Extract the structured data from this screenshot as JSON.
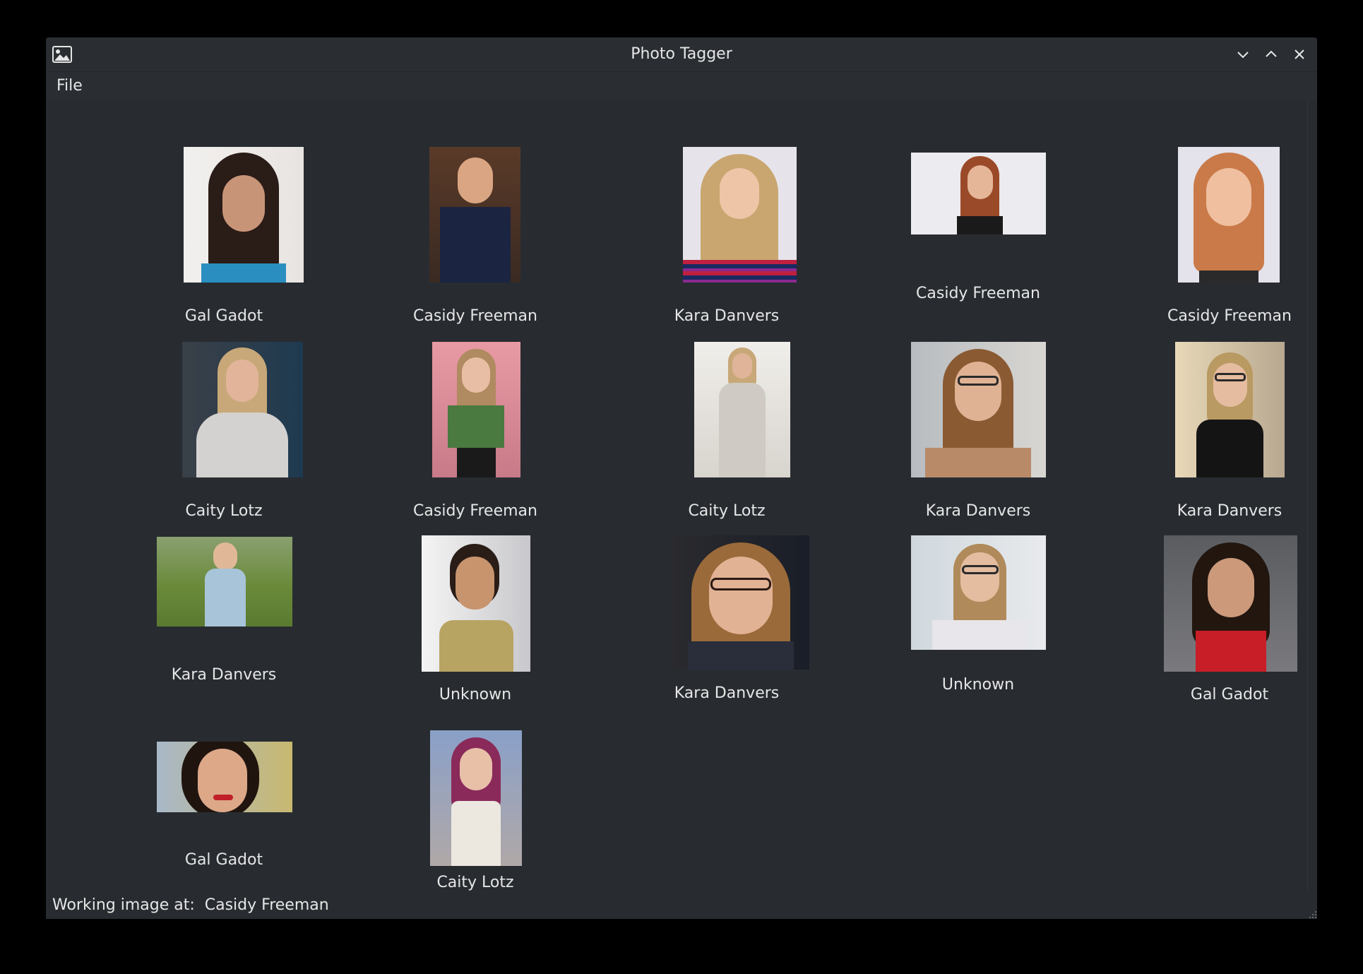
{
  "window": {
    "title": "Photo Tagger",
    "icon": "image-icon",
    "controls": [
      "minimize-icon",
      "maximize-icon",
      "close-icon"
    ]
  },
  "menu": {
    "items": [
      {
        "label": "File"
      }
    ]
  },
  "grid": {
    "items": [
      {
        "label": "Gal Gadot"
      },
      {
        "label": "Casidy Freeman"
      },
      {
        "label": "Kara Danvers"
      },
      {
        "label": "Casidy Freeman"
      },
      {
        "label": "Casidy Freeman"
      },
      {
        "label": "Caity Lotz"
      },
      {
        "label": "Casidy Freeman"
      },
      {
        "label": "Caity Lotz"
      },
      {
        "label": "Kara Danvers"
      },
      {
        "label": "Kara Danvers"
      },
      {
        "label": "Kara Danvers"
      },
      {
        "label": "Unknown"
      },
      {
        "label": "Kara Danvers"
      },
      {
        "label": "Unknown"
      },
      {
        "label": "Gal Gadot"
      },
      {
        "label": "Gal Gadot"
      },
      {
        "label": "Caity Lotz"
      }
    ]
  },
  "status": {
    "prefix": "Working image at:  ",
    "current": "Casidy Freeman"
  },
  "colors": {
    "window_bg": "#282c31",
    "titlebar_bg": "#2a2e32",
    "text": "#e6e6e6",
    "desktop": "#000000"
  }
}
